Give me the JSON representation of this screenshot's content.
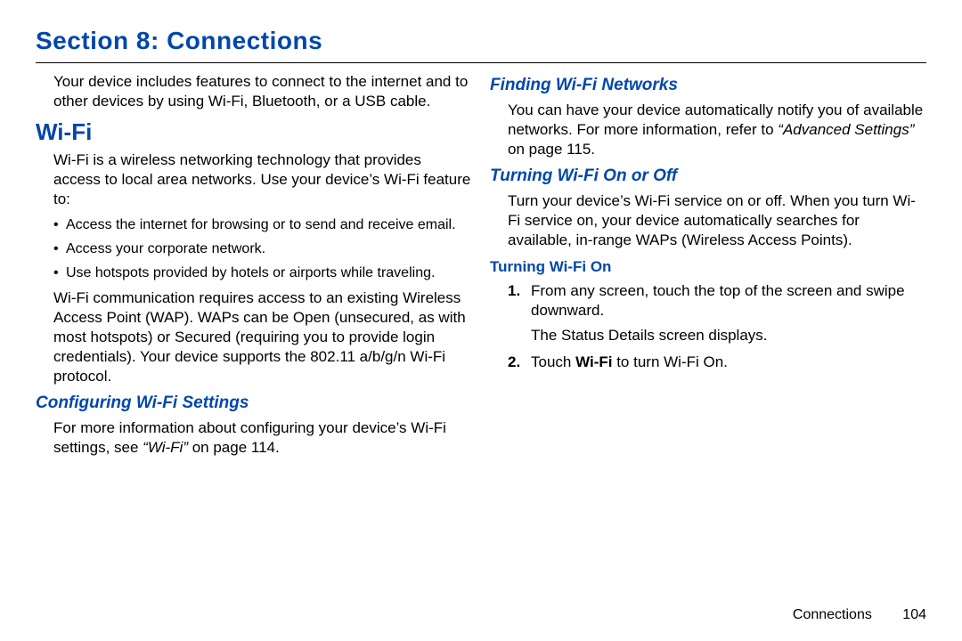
{
  "section_title": "Section 8: Connections",
  "left": {
    "intro": "Your device includes features to connect to the internet and to other devices by using Wi-Fi, Bluetooth, or a USB cable.",
    "h2": "Wi-Fi",
    "p1": "Wi-Fi is a wireless networking technology that provides access to local area networks. Use your device’s Wi-Fi feature to:",
    "bullets": [
      "Access the internet for browsing or to send and receive email.",
      "Access your corporate network.",
      "Use hotspots provided by hotels or airports while traveling."
    ],
    "p2": "Wi-Fi communication requires access to an existing Wireless Access Point (WAP). WAPs can be Open (unsecured, as with most hotspots) or Secured (requiring you to provide login credentials). Your device supports the 802.11 a/b/g/n Wi-Fi protocol.",
    "h3": "Configuring Wi-Fi Settings",
    "p3_pre": "For more information about configuring your device’s Wi-Fi settings, see ",
    "p3_ref": "“Wi-Fi”",
    "p3_post": " on page 114."
  },
  "right": {
    "h3a": "Finding Wi-Fi Networks",
    "p1_pre": "You can have your device automatically notify you of available networks. For more information, refer to ",
    "p1_ref": "“Advanced Settings”",
    "p1_post": " on page 115.",
    "h3b": "Turning Wi-Fi On or Off",
    "p2": "Turn your device’s Wi-Fi service on or off. When you turn Wi-Fi service on, your device automatically searches for available, in-range WAPs (Wireless Access Points).",
    "h4": "Turning Wi-Fi On",
    "step1_main": "From any screen, touch the top of the screen and swipe downward.",
    "step1_sub": "The Status Details screen displays.",
    "step2_pre": "Touch ",
    "step2_bold": "Wi-Fi",
    "step2_post": " to turn Wi-Fi On."
  },
  "footer": {
    "label": "Connections",
    "page": "104"
  }
}
